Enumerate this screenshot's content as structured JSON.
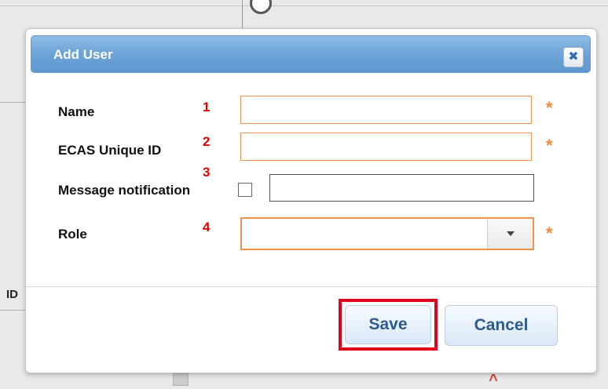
{
  "background": {
    "column_label": "ID"
  },
  "dialog": {
    "title": "Add User",
    "close_glyph": "✖",
    "fields": {
      "name": {
        "label": "Name",
        "marker": "1",
        "value": "",
        "required_mark": "*"
      },
      "ecas": {
        "label": "ECAS Unique ID",
        "marker": "2",
        "value": "",
        "required_mark": "*"
      },
      "notification": {
        "label": "Message notification",
        "marker": "3",
        "checked": false,
        "value": ""
      },
      "role": {
        "label": "Role",
        "marker": "4",
        "selected": "",
        "required_mark": "*"
      }
    },
    "buttons": {
      "save": "Save",
      "cancel": "Cancel"
    }
  },
  "colors": {
    "titlebar": "#6fa5d8",
    "required_border": "#f0914e",
    "marker_red": "#e00000",
    "highlight_red": "#e3001b",
    "button_text": "#2d5b8e"
  },
  "icons": [
    "close-icon",
    "chevron-down-icon",
    "required-star-icon"
  ]
}
